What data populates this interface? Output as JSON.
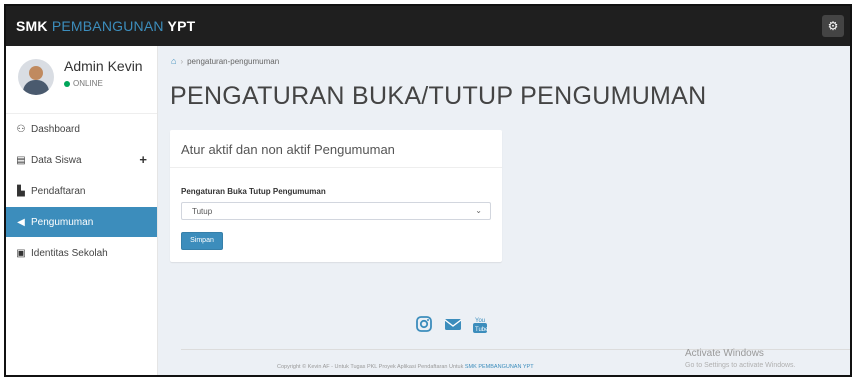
{
  "header": {
    "brand_prefix": "SMK",
    "brand_accent": "PEMBANGUNAN",
    "brand_suffix": "YPT",
    "settings_icon": "gear-icon"
  },
  "user": {
    "name": "Admin Kevin",
    "status": "ONLINE"
  },
  "sidebar": {
    "items": [
      {
        "label": "Dashboard",
        "icon": "dashboard-icon"
      },
      {
        "label": "Data Siswa",
        "icon": "database-icon",
        "expand_icon": "plus-icon"
      },
      {
        "label": "Pendaftaran",
        "icon": "file-icon"
      },
      {
        "label": "Pengumuman",
        "icon": "bullhorn-icon",
        "active": true
      },
      {
        "label": "Identitas Sekolah",
        "icon": "id-card-icon"
      }
    ]
  },
  "breadcrumb": {
    "home_icon": "home-icon",
    "current": "pengaturan-pengumuman"
  },
  "page": {
    "title": "PENGATURAN BUKA/TUTUP PENGUMUMAN"
  },
  "form": {
    "box_title": "Atur aktif dan non aktif Pengumuman",
    "field_label": "Pengaturan Buka Tutup Pengumuman",
    "selected_value": "Tutup",
    "save_label": "Simpan"
  },
  "footer": {
    "social_icons": [
      "instagram-icon",
      "mail-icon",
      "youtube-icon"
    ],
    "copyright_text": "Copyright © Kevin AF - Untuk Tugas PKL Proyek Aplikasi Pendaftaran Untuk",
    "copyright_link": "SMK PEMBANGUNAN YPT"
  },
  "watermark": {
    "title": "Activate Windows",
    "subtitle": "Go to Settings to activate Windows."
  },
  "colors": {
    "accent": "#3c8dbc",
    "topbar": "#1f1f1f",
    "online": "#00a65a"
  }
}
